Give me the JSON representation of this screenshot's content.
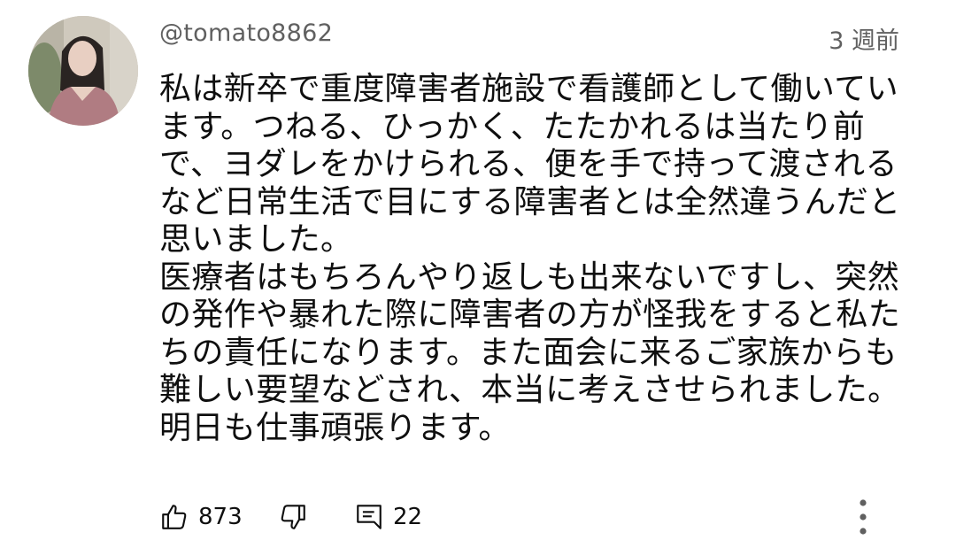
{
  "comment": {
    "author": "@tomato8862",
    "time": "3 週前",
    "lines": [
      "私は新卒で重度障害者施設で看護師として働いてい",
      "ます。つねる、ひっかく、たたかれるは当たり前",
      "で、ヨダレをかけられる、便を手で持って渡される",
      "など日常生活で目にする障害者とは全然違うんだと",
      "思いました。",
      "医療者はもちろんやり返しも出来ないですし、突然",
      "の発作や暴れた際に障害者の方が怪我をすると私た",
      "ちの責任になります。また面会に来るご家族からも",
      "難しい要望などされ、本当に考えさせられました。",
      "明日も仕事頑張ります。"
    ],
    "likes": "873",
    "replies": "22"
  },
  "icons": {
    "like": "thumbs-up-icon",
    "dislike": "thumbs-down-icon",
    "reply": "comment-icon",
    "more": "more-vertical-icon"
  },
  "colors": {
    "text": "#0f0f0f",
    "secondary": "#606060",
    "background": "#ffffff"
  }
}
